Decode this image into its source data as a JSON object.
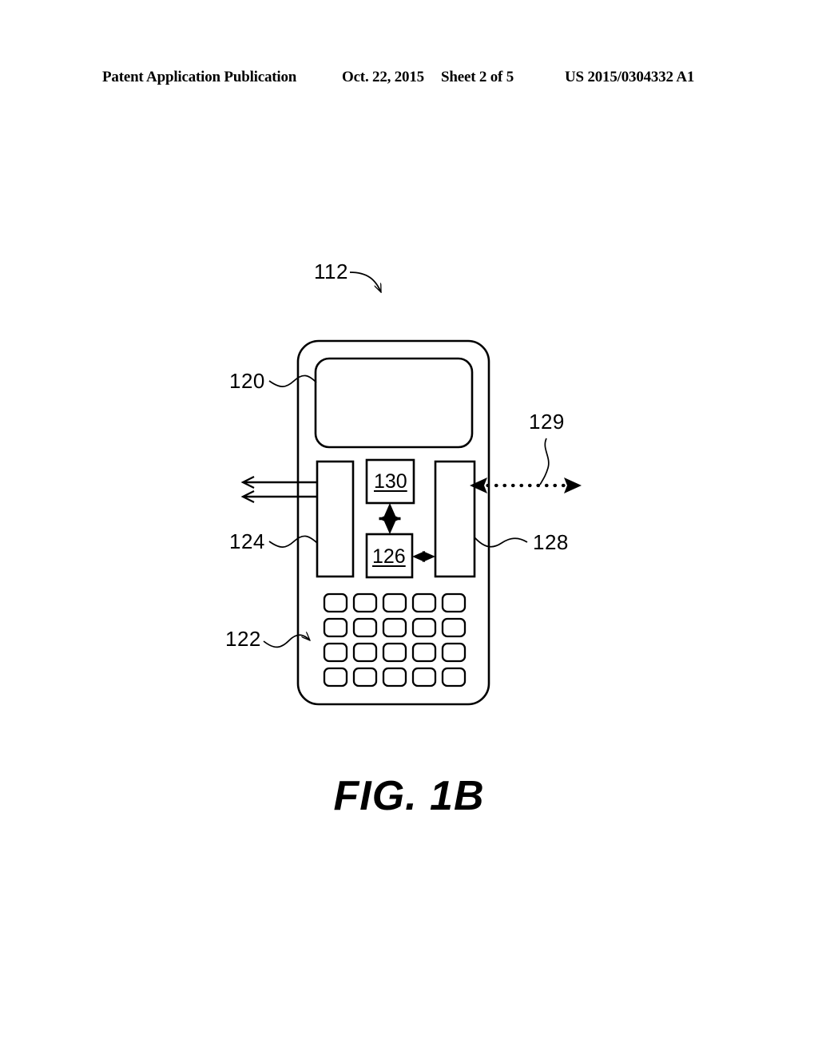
{
  "header": {
    "publication": "Patent Application Publication",
    "date": "Oct. 22, 2015",
    "sheet": "Sheet 2 of 5",
    "document_number": "US 2015/0304332 A1"
  },
  "figure": {
    "caption": "FIG. 1B",
    "reference_labels": {
      "device": "112",
      "display": "120",
      "keypad": "122",
      "left_interface_block": "124",
      "right_interface_block": "128",
      "wireless_link": "129",
      "processor_block": "126",
      "memory_block": "130"
    },
    "block_text": {
      "upper_block": "130",
      "lower_block": "126"
    },
    "keypad": {
      "columns": 5,
      "rows": 4,
      "key_count": 20
    },
    "colors": {
      "stroke": "#000000",
      "background": "#ffffff"
    }
  }
}
